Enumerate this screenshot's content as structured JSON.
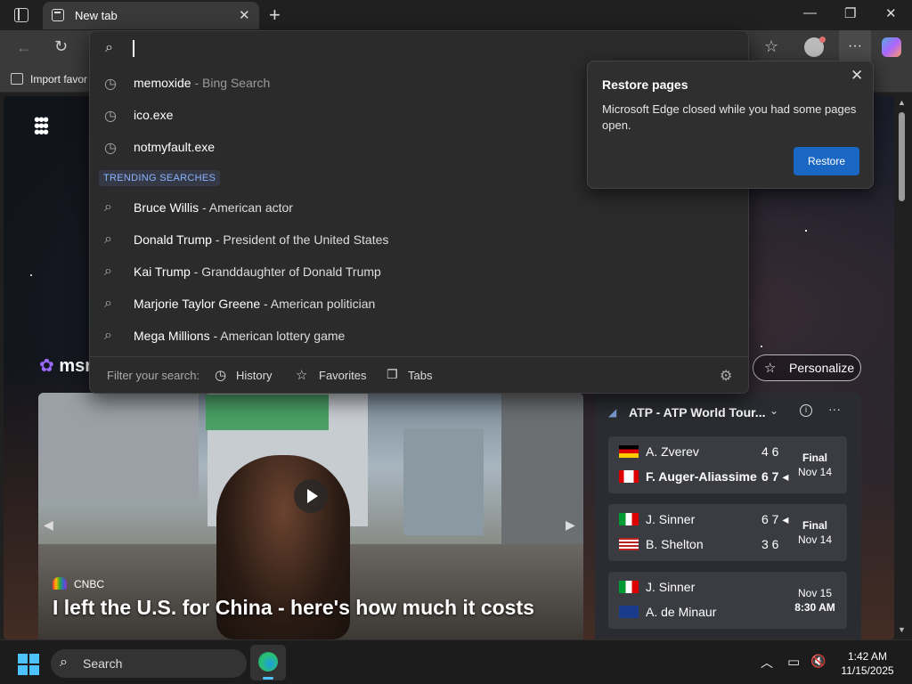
{
  "browser": {
    "tab_title": "New tab",
    "favbar_text": "Import favor"
  },
  "dropdown": {
    "history": [
      {
        "text": "memoxide",
        "sub": " - Bing Search"
      },
      {
        "text": "ico.exe",
        "sub": ""
      },
      {
        "text": "notmyfault.exe",
        "sub": ""
      }
    ],
    "trending_label": "TRENDING SEARCHES",
    "trending": [
      {
        "text": "Bruce Willis",
        "sub": " - American actor"
      },
      {
        "text": "Donald Trump",
        "sub": " - President of the United States"
      },
      {
        "text": "Kai Trump",
        "sub": " - Granddaughter of Donald Trump"
      },
      {
        "text": "Marjorie Taylor Greene",
        "sub": " - American politician"
      },
      {
        "text": "Mega Millions",
        "sub": " - American lottery game"
      }
    ],
    "filter_label": "Filter your search:",
    "filter_history": "History",
    "filter_favorites": "Favorites",
    "filter_tabs": "Tabs"
  },
  "restore": {
    "title": "Restore pages",
    "message": "Microsoft Edge closed while you had some pages open.",
    "button": "Restore"
  },
  "page": {
    "msn_label": "msn",
    "personalize": "Personalize",
    "hero_source": "CNBC",
    "hero_headline": "I left the U.S. for China - here's how much it costs"
  },
  "sports": {
    "title": "ATP - ATP World Tour...",
    "matches": [
      {
        "p1": "A. Zverev",
        "s1": "4 6",
        "p2": "F. Auger-Aliassime",
        "s2": "6 7 ◂",
        "status1": "Final",
        "status2": "Nov 14"
      },
      {
        "p1": "J. Sinner",
        "s1": "6 7 ◂",
        "p2": "B. Shelton",
        "s2": "3 6",
        "status1": "Final",
        "status2": "Nov 14"
      },
      {
        "p1": "J. Sinner",
        "s1": "",
        "p2": "A. de Minaur",
        "s2": "",
        "status1": "Nov 15",
        "status2": "8:30 AM"
      }
    ]
  },
  "taskbar": {
    "search": "Search",
    "time": "1:42 AM",
    "date": "11/15/2025"
  },
  "colors": {
    "accent": "#1b68c4",
    "trending": "#8ab4ff"
  }
}
